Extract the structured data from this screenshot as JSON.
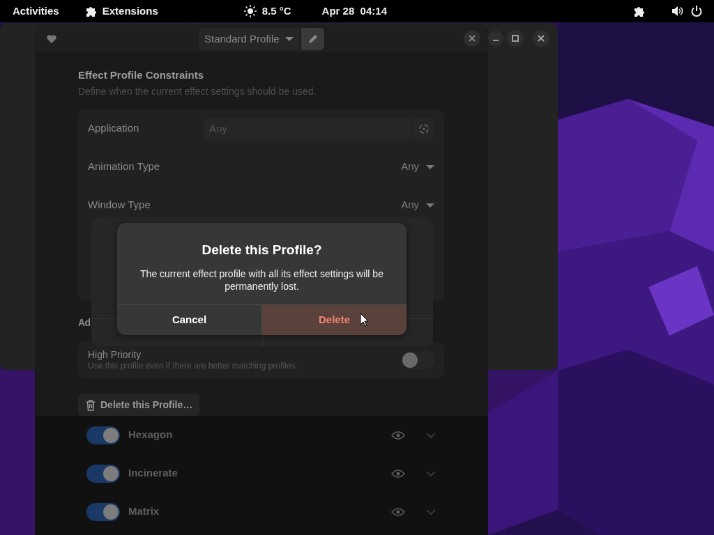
{
  "top_bar": {
    "activities": "Activities",
    "extensions": "Extensions",
    "weather": "8.5 °C",
    "clock": "Apr 28  04:14"
  },
  "window": {
    "profile_dropdown": "Standard Profile",
    "constraints": {
      "title": "Effect Profile Constraints",
      "subtitle": "Define when the current effect settings should be used.",
      "rows": [
        {
          "kind": "field",
          "label": "Application",
          "placeholder": "Any"
        },
        {
          "kind": "dropdown",
          "label": "Animation Type",
          "value": "Any"
        },
        {
          "kind": "dropdown",
          "label": "Window Type",
          "value": "Any"
        }
      ]
    },
    "advanced_heading": "Ad",
    "high_priority": {
      "label": "High Priority",
      "description": "Use this profile even if there are better matching profiles.",
      "on": false
    },
    "delete_button": "Delete this Profile…",
    "effects": [
      {
        "name": "Hexagon",
        "on": true
      },
      {
        "name": "Incinerate",
        "on": true
      },
      {
        "name": "Matrix",
        "on": true
      }
    ]
  },
  "dialog": {
    "title": "Delete this Profile?",
    "body": "The current effect profile with all its effect settings will be permanently lost.",
    "buttons": [
      {
        "label": "Cancel",
        "kind": "normal"
      },
      {
        "label": "Delete",
        "kind": "destructive"
      }
    ]
  }
}
